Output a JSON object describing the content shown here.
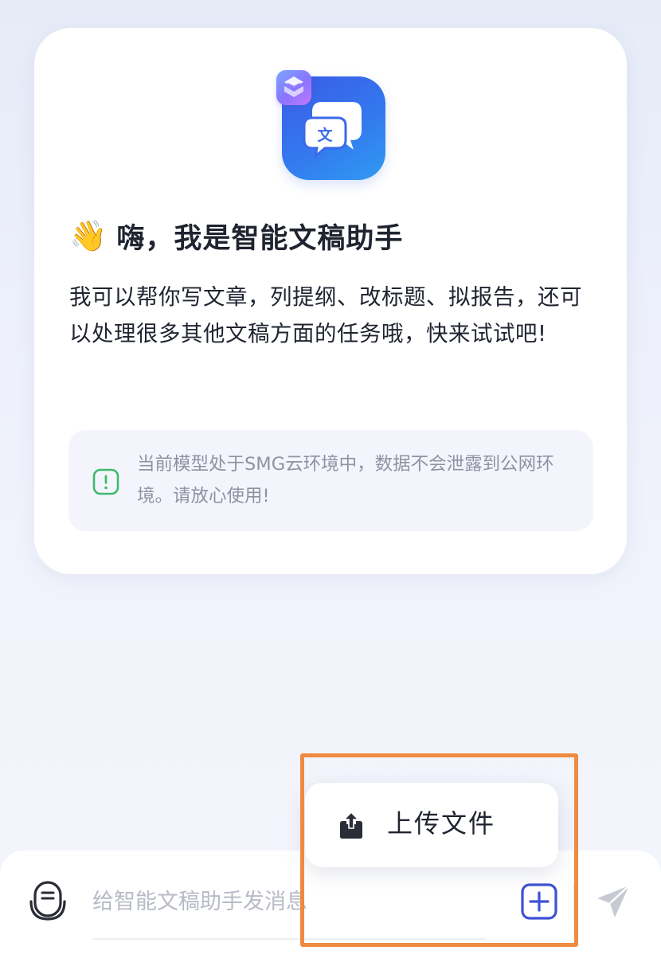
{
  "greeting": {
    "emoji": "👋",
    "title": "嗨，我是智能文稿助手"
  },
  "intro_text": "我可以帮你写文章，列提纲、改标题、拟报告，还可以处理很多其他文稿方面的任务哦，快来试试吧!",
  "notice": {
    "icon": "exclamation-square-icon",
    "text": "当前模型处于SMG云环境中，数据不会泄露到公网环境。请放心使用!",
    "icon_color": "#3dbb6c"
  },
  "input": {
    "placeholder": "给智能文稿助手发消息",
    "value": ""
  },
  "popup_menu": {
    "items": [
      {
        "label": "上传文件",
        "icon": "upload-icon"
      }
    ]
  },
  "icons": {
    "mic": "voice-input-icon",
    "plus": "plus-square-icon",
    "send": "send-icon"
  },
  "colors": {
    "accent": "#3d52d5",
    "logo_gradient_start": "#3a5be6",
    "logo_gradient_end": "#2f9bf3",
    "highlight": "#ef8a42",
    "text_primary": "#1f2430",
    "text_secondary": "#8d93a3"
  }
}
